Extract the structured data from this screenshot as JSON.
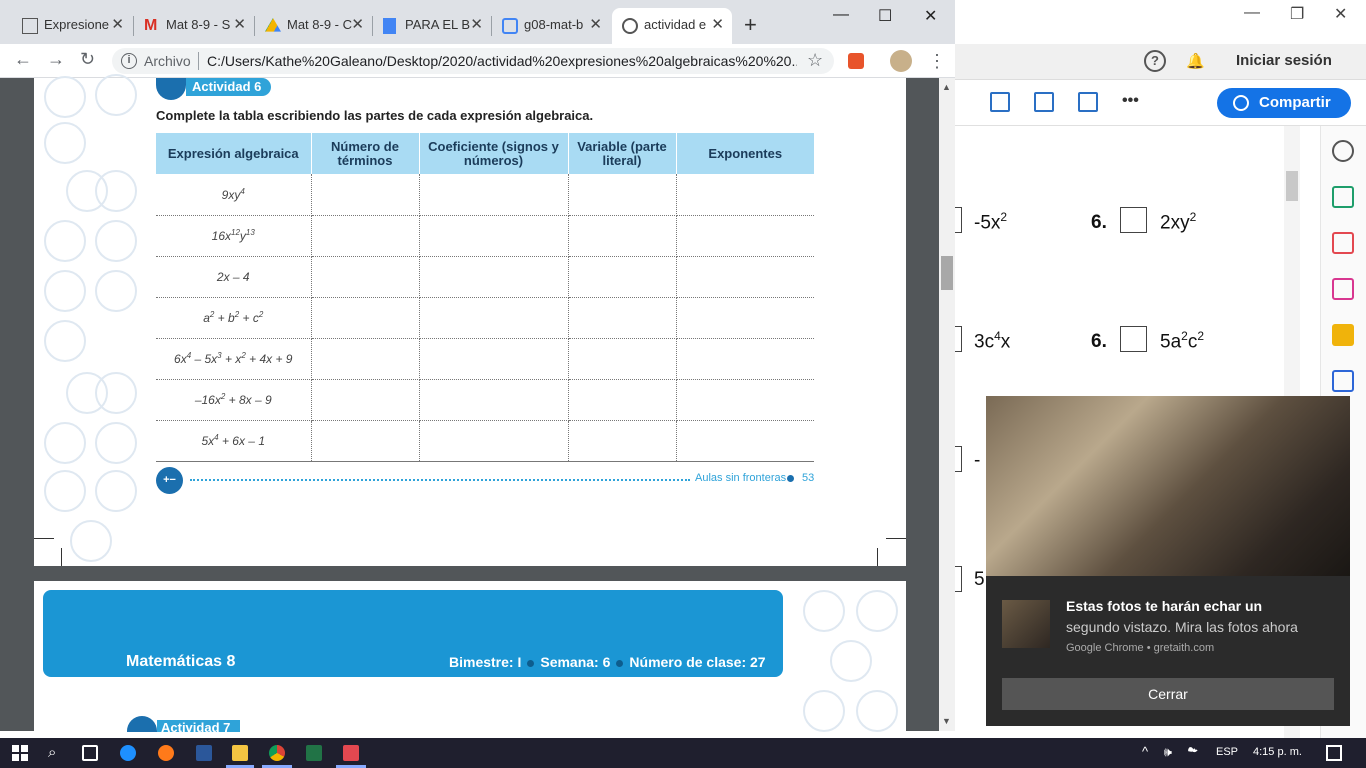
{
  "tabs": [
    {
      "label": "Expresione",
      "favicon": "file-icon",
      "active": false
    },
    {
      "label": "Mat 8-9 - S",
      "favicon": "gmail-icon",
      "active": false
    },
    {
      "label": "Mat 8-9 - C",
      "favicon": "drive-icon",
      "active": false
    },
    {
      "label": "PARA EL B",
      "favicon": "docs-icon",
      "active": false
    },
    {
      "label": "g08-mat-b",
      "favicon": "classroom-icon",
      "active": false
    },
    {
      "label": "actividad e",
      "favicon": "globe-icon",
      "active": true
    }
  ],
  "window": {
    "minimize": "—",
    "maximize": "☐",
    "close": "✕"
  },
  "address": {
    "scheme": "Archivo",
    "url": "C:/Users/Kathe%20Galeano/Desktop/2020/actividad%20expresiones%20algebraicas%20%20..."
  },
  "page": {
    "activity6_label": "Actividad 6",
    "instruction": "Complete la tabla escribiendo las partes de cada expresión algebraica.",
    "headers": [
      "Expresión algebraica",
      "Número de términos",
      "Coeficiente (signos y números)",
      "Variable (parte literal)",
      "Exponentes"
    ],
    "expressions": [
      {
        "base": "9xy",
        "sup": "4",
        "rest": ""
      },
      {
        "base": "16x",
        "sup": "12",
        "base2": "y",
        "sup2": "13"
      },
      {
        "base": "2x – 4"
      },
      {
        "base": "a",
        "sup": "2",
        "base2": " + b",
        "sup2": "2",
        "base3": " + c",
        "sup3": "2"
      },
      {
        "base": "6x",
        "sup": "4",
        "base2": " – 5x",
        "sup2": "3",
        "base3": " + x",
        "sup3": "2",
        "tail": " + 4x + 9"
      },
      {
        "base": "–16x",
        "sup": "2",
        "tail": " + 8x – 9"
      },
      {
        "base": "5x",
        "sup": "4",
        "tail": " + 6x – 1"
      }
    ],
    "footer_text": "Aulas sin fronteras",
    "page_number": "53",
    "footer_icon_text": "+−\n×÷",
    "banner_title": "Matemáticas 8",
    "banner_bimestre": "Bimestre: I",
    "banner_semana": "Semana: 6",
    "banner_clase": "Número de clase: 27",
    "activity7_label": "Actividad 7"
  },
  "right_app": {
    "signin": "Iniciar sesión",
    "share": "Compartir",
    "toolbar_more": "•••",
    "rows": [
      {
        "left": "-5x",
        "left_sup": "2",
        "num": "6.",
        "right": "2xy",
        "right_sup": "2"
      },
      {
        "left": "3c",
        "left_sup": "4",
        "left_tail": "x",
        "num": "6.",
        "right": "5a",
        "right_sup": "2",
        "right_tail": "c",
        "right_sup2": "2"
      }
    ],
    "partial1": "-",
    "partial2": "5"
  },
  "notification": {
    "title": "Estas fotos te harán echar un",
    "body": "segundo vistazo. Mira las fotos ahora",
    "source": "Google Chrome • gretaith.com",
    "close": "Cerrar"
  },
  "taskbar": {
    "language": "ESP",
    "time": "4:15 p. m.",
    "tray": "^ 🕪 ☁"
  },
  "colors": {
    "accent": "#1473e6",
    "banner": "#1b96d4",
    "header": "#a9dbf3"
  }
}
